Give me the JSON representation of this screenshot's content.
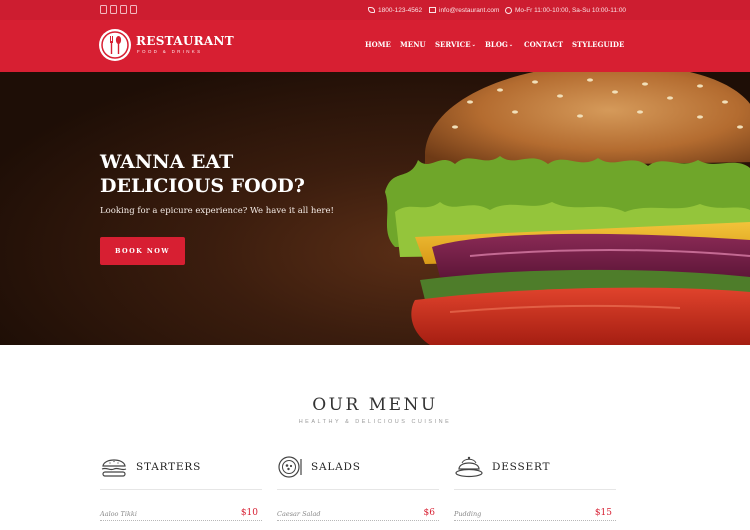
{
  "topbar": {
    "social_icons": [
      "facebook-icon",
      "linkedin-icon",
      "twitter-icon",
      "google-plus-icon"
    ],
    "phone": "1800-123-4562",
    "email": "info@restaurant.com",
    "hours": "Mo-Fr 11:00-10:00, Sa-Su 10:00-11:00"
  },
  "brand": {
    "name": "RESTAURANT",
    "tagline": "FOOD & DRINKS"
  },
  "nav": {
    "items": [
      {
        "label": "HOME",
        "dropdown": false
      },
      {
        "label": "MENU",
        "dropdown": false
      },
      {
        "label": "SERVICE",
        "dropdown": true
      },
      {
        "label": "BLOG",
        "dropdown": true
      },
      {
        "label": "CONTACT",
        "dropdown": false
      },
      {
        "label": "STYLEGUIDE",
        "dropdown": false
      }
    ],
    "caret": "⌄"
  },
  "hero": {
    "title_line1": "WANNA EAT",
    "title_line2": "DELICIOUS FOOD?",
    "subtitle": "Looking for a epicure experience? We have it all here!",
    "button": "BOOK NOW"
  },
  "menu": {
    "title": "OUR MENU",
    "subtitle": "HEALTHY & DELICIOUS CUISINE",
    "categories": [
      {
        "name": "STARTERS",
        "icon": "burger-icon",
        "items": [
          {
            "name": "Aaloo Tikki",
            "price": "$10"
          },
          {
            "name": "",
            "price": ""
          }
        ]
      },
      {
        "name": "SALADS",
        "icon": "salad-plate-icon",
        "items": [
          {
            "name": "Caesar Salad",
            "price": "$6"
          },
          {
            "name": "",
            "price": ""
          }
        ]
      },
      {
        "name": "DESSERT",
        "icon": "cake-icon",
        "items": [
          {
            "name": "Pudding",
            "price": "$15"
          },
          {
            "name": "",
            "price": ""
          }
        ]
      }
    ]
  },
  "colors": {
    "brand_red": "#d71f32",
    "topbar_red": "#cd1d30"
  }
}
